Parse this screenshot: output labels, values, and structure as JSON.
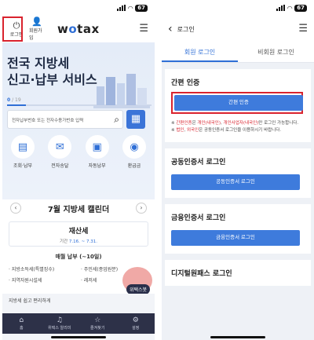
{
  "left": {
    "status": {
      "time": "",
      "battery": "67"
    },
    "header": {
      "login_label": "로그인",
      "signup_label": "회원가입",
      "logo_a": "w",
      "logo_o": "o",
      "logo_b": "tax"
    },
    "hero": {
      "line1": "전국 지방세",
      "line2": "신고·납부 서비스",
      "page_current": "0",
      "page_total": "/ 19",
      "search_placeholder": "전자납부번호 또는 전자수용가번호 입력"
    },
    "quick_menu": [
      {
        "label": "조회·납부"
      },
      {
        "label": "전자송달"
      },
      {
        "label": "자동납부"
      },
      {
        "label": "환급금"
      }
    ],
    "calendar": {
      "title": "7월 지방세 캘린더",
      "item_name": "재산세",
      "period_label": "기간",
      "period": "7.16. ~ 7.31.",
      "monthly": "매월 납부 (~10일)",
      "list": [
        "지방소득세(특별징수)",
        "주민세(종업원분)",
        "지역자원시설세",
        "레저세"
      ]
    },
    "banner": "지방세 쉽고 편리하게",
    "mascot_label": "위택스봇",
    "tabbar": [
      {
        "label": "홈"
      },
      {
        "label": "위택스 알리미"
      },
      {
        "label": "즐겨찾기"
      },
      {
        "label": "설정"
      }
    ]
  },
  "right": {
    "status": {
      "time": "",
      "battery": "67"
    },
    "header": {
      "title": "로그인"
    },
    "tabs": [
      {
        "label": "회원 로그인"
      },
      {
        "label": "비회원 로그인"
      }
    ],
    "simple": {
      "title": "간편 인증",
      "button": "간편 인증",
      "note1_prefix": "※ ",
      "note1_hl": "간편인증",
      "note1_mid": "은 ",
      "note1_hl2": "개인(내국인)",
      "note1_sep": ", ",
      "note1_hl3": "개인사업자(내국인)",
      "note1_suffix": "만 로그인 가능합니다.",
      "note2_prefix": "※ ",
      "note2_hl": "법인",
      "note2_sep": ", ",
      "note2_hl2": "외국인",
      "note2_suffix": "은 공동인증서 로그인을 이용하시기 바랍니다."
    },
    "joint": {
      "title": "공동인증서 로그인",
      "button": "공동인증서 로그인"
    },
    "finance": {
      "title": "금융인증서 로그인",
      "button": "금융인증서 로그인"
    },
    "digital": {
      "title": "디지털원패스 로그인"
    }
  },
  "colors": {
    "accent": "#2f6fd6",
    "button": "#3e7bdc",
    "highlight_box": "#d9232e",
    "tabbar": "#2d3148"
  }
}
